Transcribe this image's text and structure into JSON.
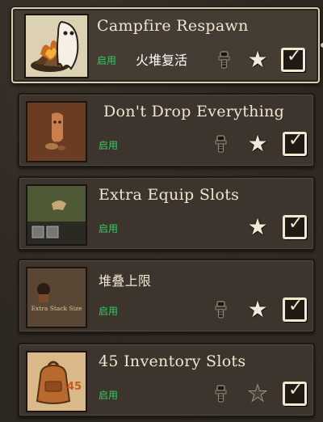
{
  "mods": [
    {
      "title": "Campfire Respawn",
      "subtitle": "火堆复活",
      "status": "启用",
      "has_config": true,
      "favorite": true,
      "enabled": true,
      "selected": true
    },
    {
      "title": "Don't Drop Everything",
      "status": "启用",
      "has_config": true,
      "favorite": true,
      "enabled": true
    },
    {
      "title": "Extra Equip Slots",
      "status": "启用",
      "has_config": false,
      "favorite": true,
      "enabled": true
    },
    {
      "title": "堆叠上限",
      "status": "启用",
      "has_config": true,
      "favorite": true,
      "enabled": true
    },
    {
      "title": "45 Inventory Slots",
      "status": "启用",
      "has_config": true,
      "favorite": false,
      "enabled": true
    }
  ],
  "thumbnails": {
    "row4_caption": "Extra Stack Size",
    "row5_badge": "45"
  },
  "glyphs": {
    "star": "★",
    "check": "✓"
  },
  "colors": {
    "enabled_status": "#37c964",
    "title_text": "#efe6cf",
    "panel": "#3d352d"
  }
}
